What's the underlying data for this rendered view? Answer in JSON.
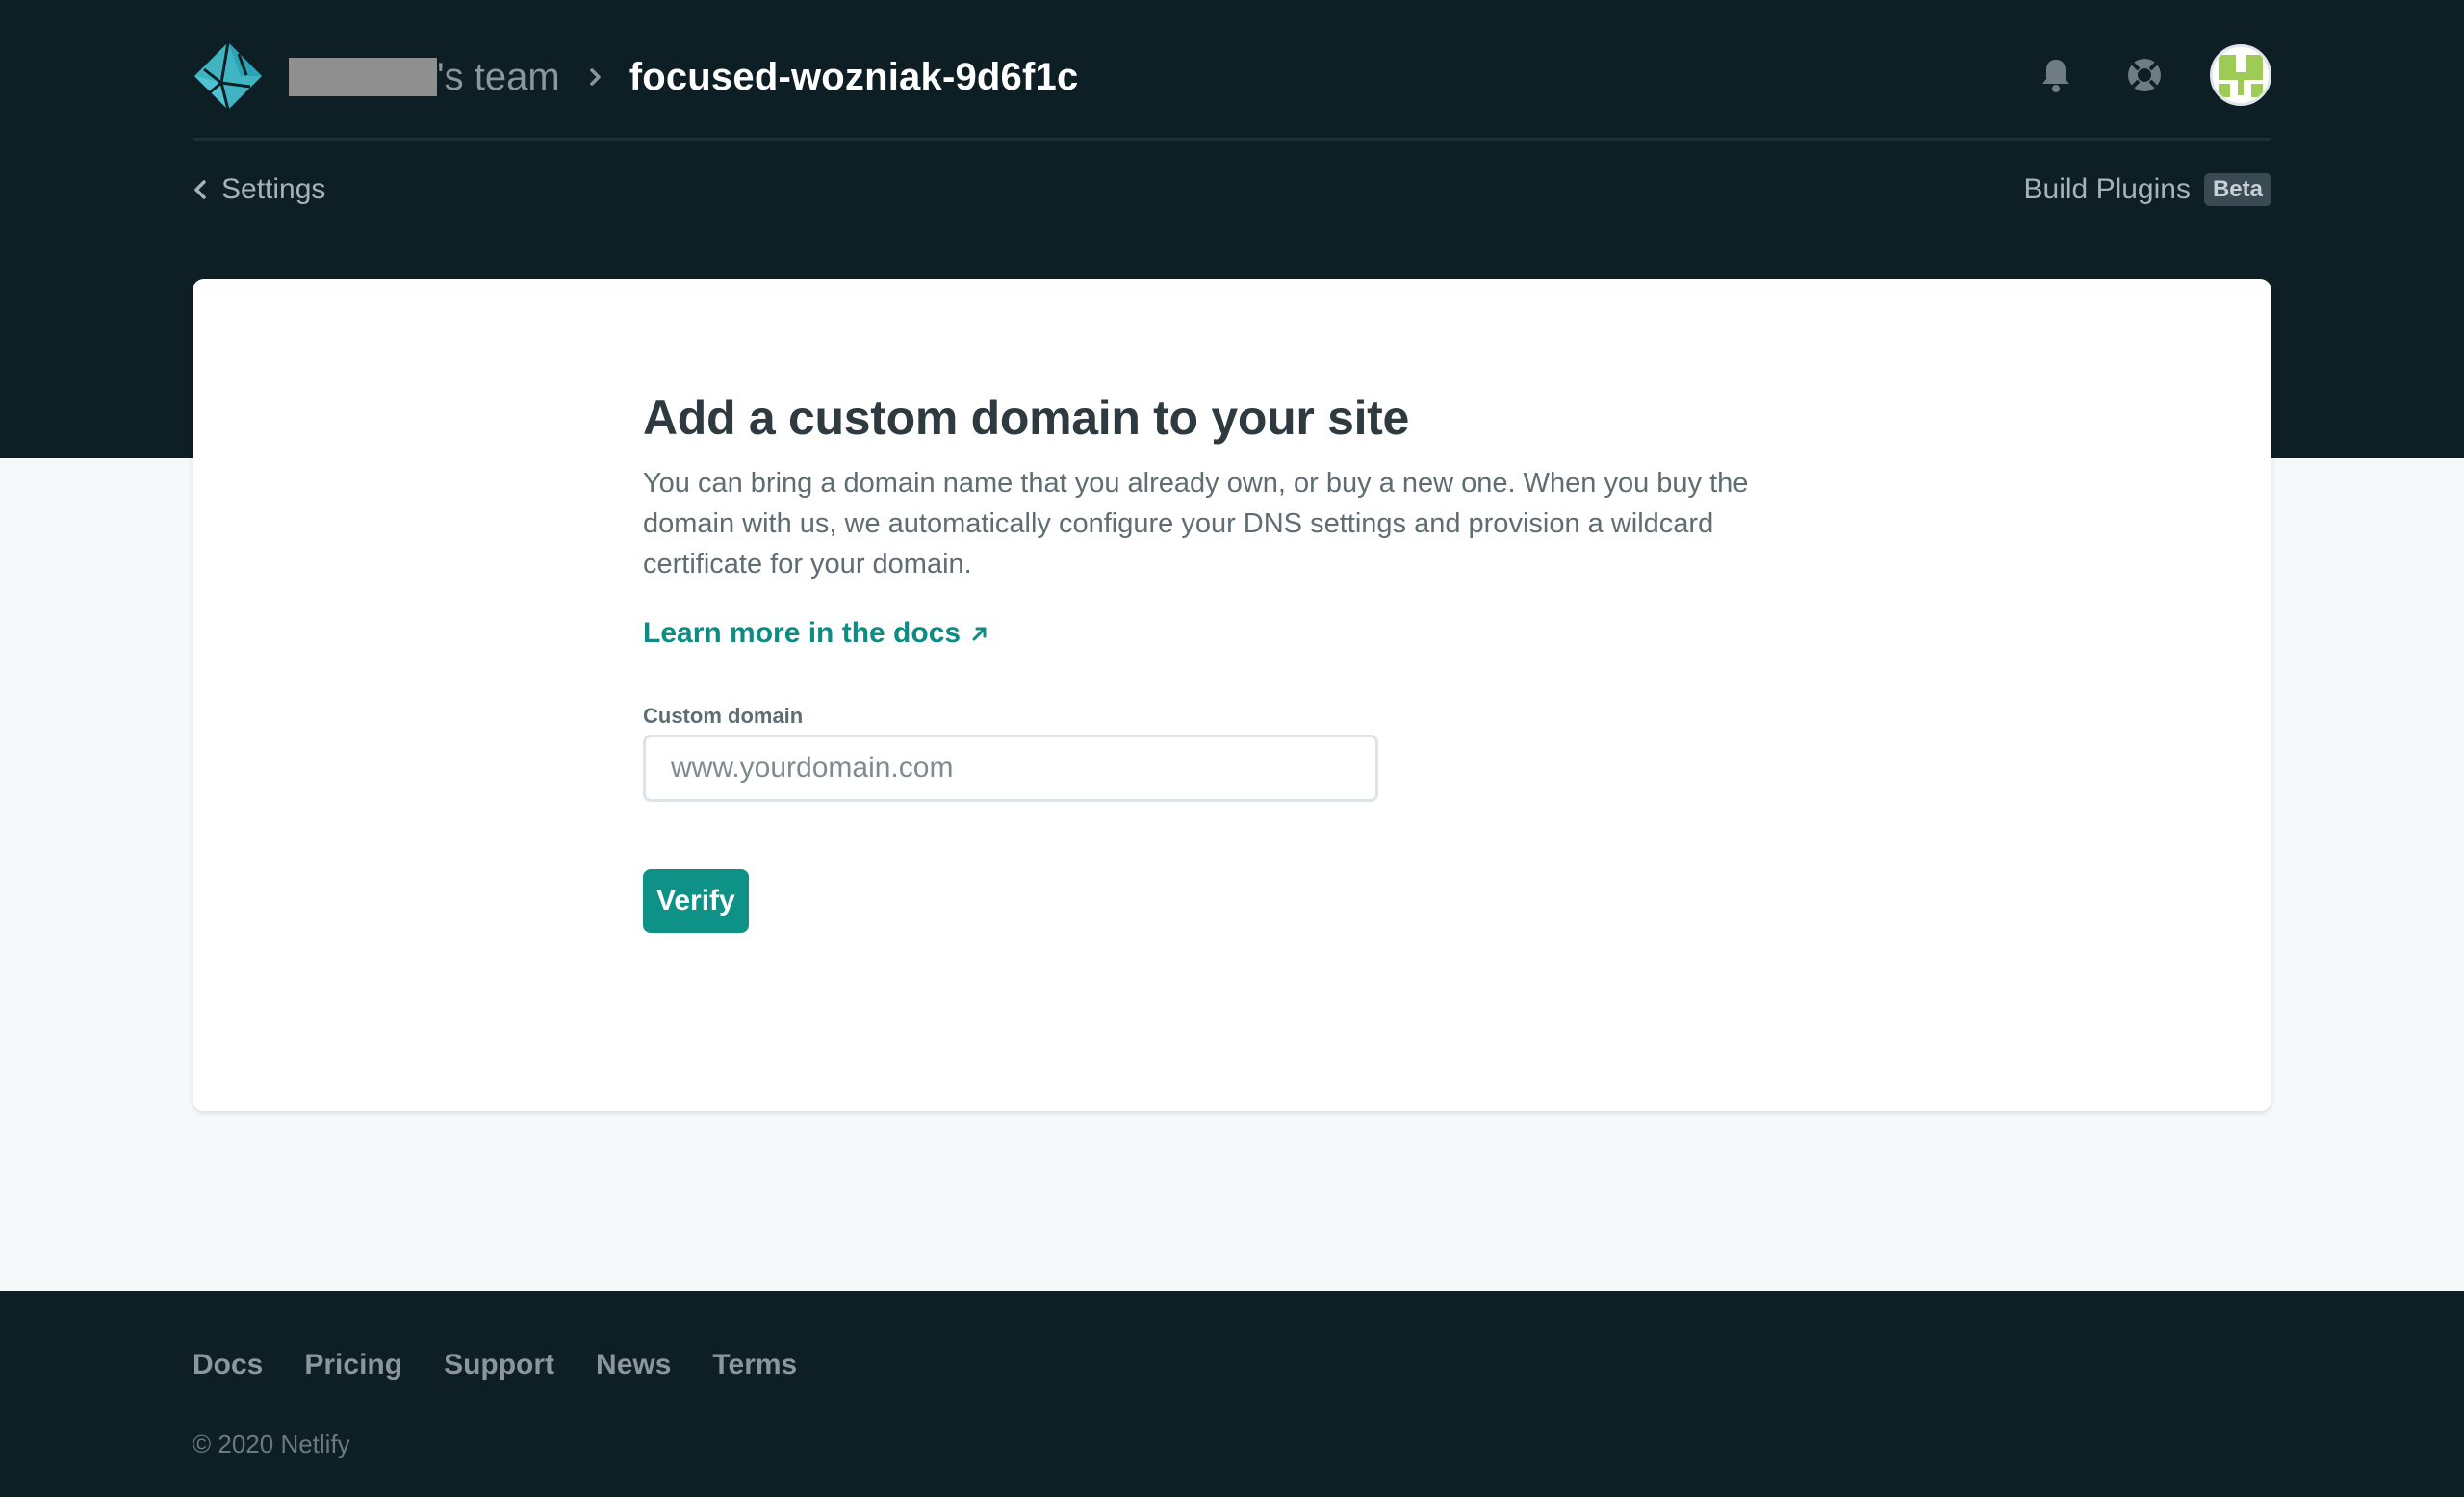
{
  "header": {
    "team_suffix": "'s team",
    "site_name": "focused-wozniak-9d6f1c",
    "icons": [
      "netlify-logo",
      "chevron-right-icon",
      "bell-icon",
      "lifebuoy-icon",
      "avatar"
    ]
  },
  "subnav": {
    "back_label": "Settings",
    "plugins_label": "Build Plugins",
    "plugins_badge": "Beta"
  },
  "main": {
    "title": "Add a custom domain to your site",
    "description": "You can bring a domain name that you already own, or buy a new one. When you buy the domain with us, we automatically configure your DNS settings and provision a wildcard certificate for your domain.",
    "docs_link": "Learn more in the docs",
    "field_label": "Custom domain",
    "input_placeholder": "www.yourdomain.com",
    "input_value": "",
    "verify_label": "Verify"
  },
  "footer": {
    "links": [
      "Docs",
      "Pricing",
      "Support",
      "News",
      "Terms"
    ],
    "copyright": "© 2020 Netlify"
  },
  "colors": {
    "header_bg": "#0e1e25",
    "accent": "#0e9187",
    "link": "#0e8c84",
    "page_bg": "#f6f9fa"
  }
}
